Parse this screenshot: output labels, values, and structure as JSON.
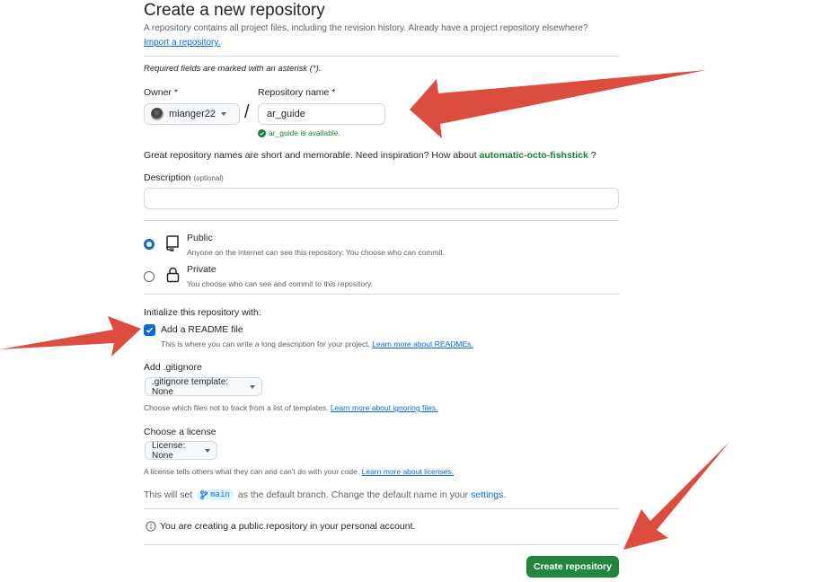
{
  "header": {
    "title": "Create a new repository",
    "description": "A repository contains all project files, including the revision history. Already have a project repository elsewhere?",
    "import_link": "Import a repository."
  },
  "required_note": "Required fields are marked with an asterisk (*).",
  "owner": {
    "label": "Owner *",
    "value": "mianger22"
  },
  "separator": "/",
  "repo_name": {
    "label": "Repository name *",
    "value": "ar_guide",
    "availability": "ar_guide is available."
  },
  "suggestion": {
    "text": "Great repository names are short and memorable. Need inspiration? How about",
    "name": "automatic-octo-fishstick",
    "suffix": "?"
  },
  "description_field": {
    "label": "Description",
    "optional": "(optional)",
    "value": ""
  },
  "visibility": {
    "selected": "public",
    "public": {
      "title": "Public",
      "desc": "Anyone on the internet can see this repository. You choose who can commit."
    },
    "private": {
      "title": "Private",
      "desc": "You choose who can see and commit to this repository."
    }
  },
  "initialize": {
    "heading": "Initialize this repository with:",
    "readme": {
      "label": "Add a README file",
      "checked": true,
      "desc": "This is where you can write a long description for your project.",
      "link": "Learn more about READMEs."
    }
  },
  "gitignore": {
    "heading": "Add .gitignore",
    "button": ".gitignore template: None",
    "desc": "Choose which files not to track from a list of templates.",
    "link": "Learn more about ignoring files."
  },
  "license": {
    "heading": "Choose a license",
    "button": "License: None",
    "desc": "A license tells others what they can and can't do with your code.",
    "link": "Learn more about licenses."
  },
  "branch": {
    "prefix": "This will set",
    "name": "main",
    "middle": "as the default branch. Change the default name in your",
    "link": "settings",
    "suffix": "."
  },
  "info": "You are creating a public repository in your personal account.",
  "submit": "Create repository",
  "colors": {
    "primary_green": "#1f883d",
    "accent_blue": "#0969da",
    "annotation_red": "#dc4c3f",
    "success_green": "#1a7f37"
  },
  "icons": [
    "user-avatar",
    "check-circle-icon",
    "repo-icon",
    "lock-icon",
    "git-branch-icon",
    "info-icon",
    "caret-down-icon",
    "checkmark-icon",
    "arrow-annotation"
  ]
}
